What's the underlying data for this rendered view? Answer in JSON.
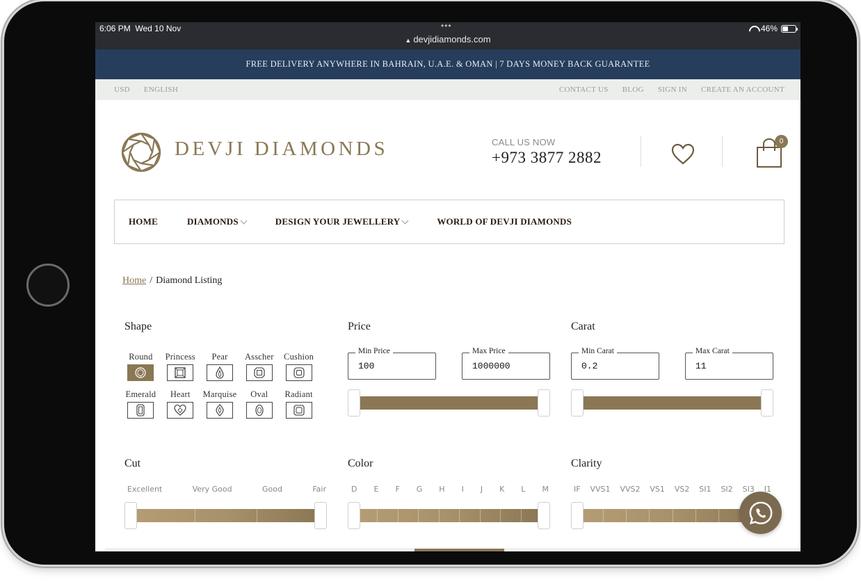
{
  "status": {
    "time": "6:06 PM",
    "date": "Wed 10 Nov",
    "url": "devjidiamonds.com",
    "battery": "46%",
    "battery_level": 0.46
  },
  "promo": "FREE DELIVERY ANYWHERE IN BAHRAIN, U.A.E. & OMAN | 7 DAYS MONEY BACK GUARANTEE",
  "topbar": {
    "currency": "USD",
    "language": "ENGLISH",
    "links": [
      "CONTACT US",
      "BLOG",
      "SIGN IN",
      "CREATE AN ACCOUNT"
    ]
  },
  "header": {
    "brand": "DEVJI DIAMONDS",
    "call_label": "CALL US NOW",
    "call_number": "+973 3877 2882",
    "cart_count": "0"
  },
  "nav": [
    "HOME",
    "DIAMONDS",
    "DESIGN YOUR JEWELLERY",
    "WORLD OF DEVJI DIAMONDS"
  ],
  "breadcrumb": {
    "home": "Home",
    "separator": "/",
    "current": "Diamond Listing"
  },
  "filters": {
    "shape": {
      "title": "Shape",
      "row1": [
        "Round",
        "Princess",
        "Pear",
        "Asscher",
        "Cushion"
      ],
      "row2": [
        "Emerald",
        "Heart",
        "Marquise",
        "Oval",
        "Radiant"
      ],
      "selected": "Round"
    },
    "price": {
      "title": "Price",
      "min_label": "Min Price",
      "min": "100",
      "max_label": "Max Price",
      "max": "1000000"
    },
    "carat": {
      "title": "Carat",
      "min_label": "Min Carat",
      "min": "0.2",
      "max_label": "Max Carat",
      "max": "11"
    },
    "cut": {
      "title": "Cut",
      "labels": [
        "Excellent",
        "Very Good",
        "Good",
        "Fair"
      ]
    },
    "color": {
      "title": "Color",
      "labels": [
        "D",
        "E",
        "F",
        "G",
        "H",
        "I",
        "J",
        "K",
        "L",
        "M"
      ]
    },
    "clarity": {
      "title": "Clarity",
      "labels": [
        "IF",
        "VVS1",
        "VVS2",
        "VS1",
        "VS2",
        "SI1",
        "SI2",
        "SI3",
        "I1"
      ]
    }
  },
  "colors": {
    "accent": "#8a7755",
    "banner": "#263d5c",
    "topbar": "#eceeec"
  },
  "icons": [
    "lock-icon",
    "wifi-icon",
    "battery-icon",
    "diamond-logo-icon",
    "heart-icon",
    "shopping-bag-icon",
    "chevron-down-icon",
    "whatsapp-icon"
  ]
}
